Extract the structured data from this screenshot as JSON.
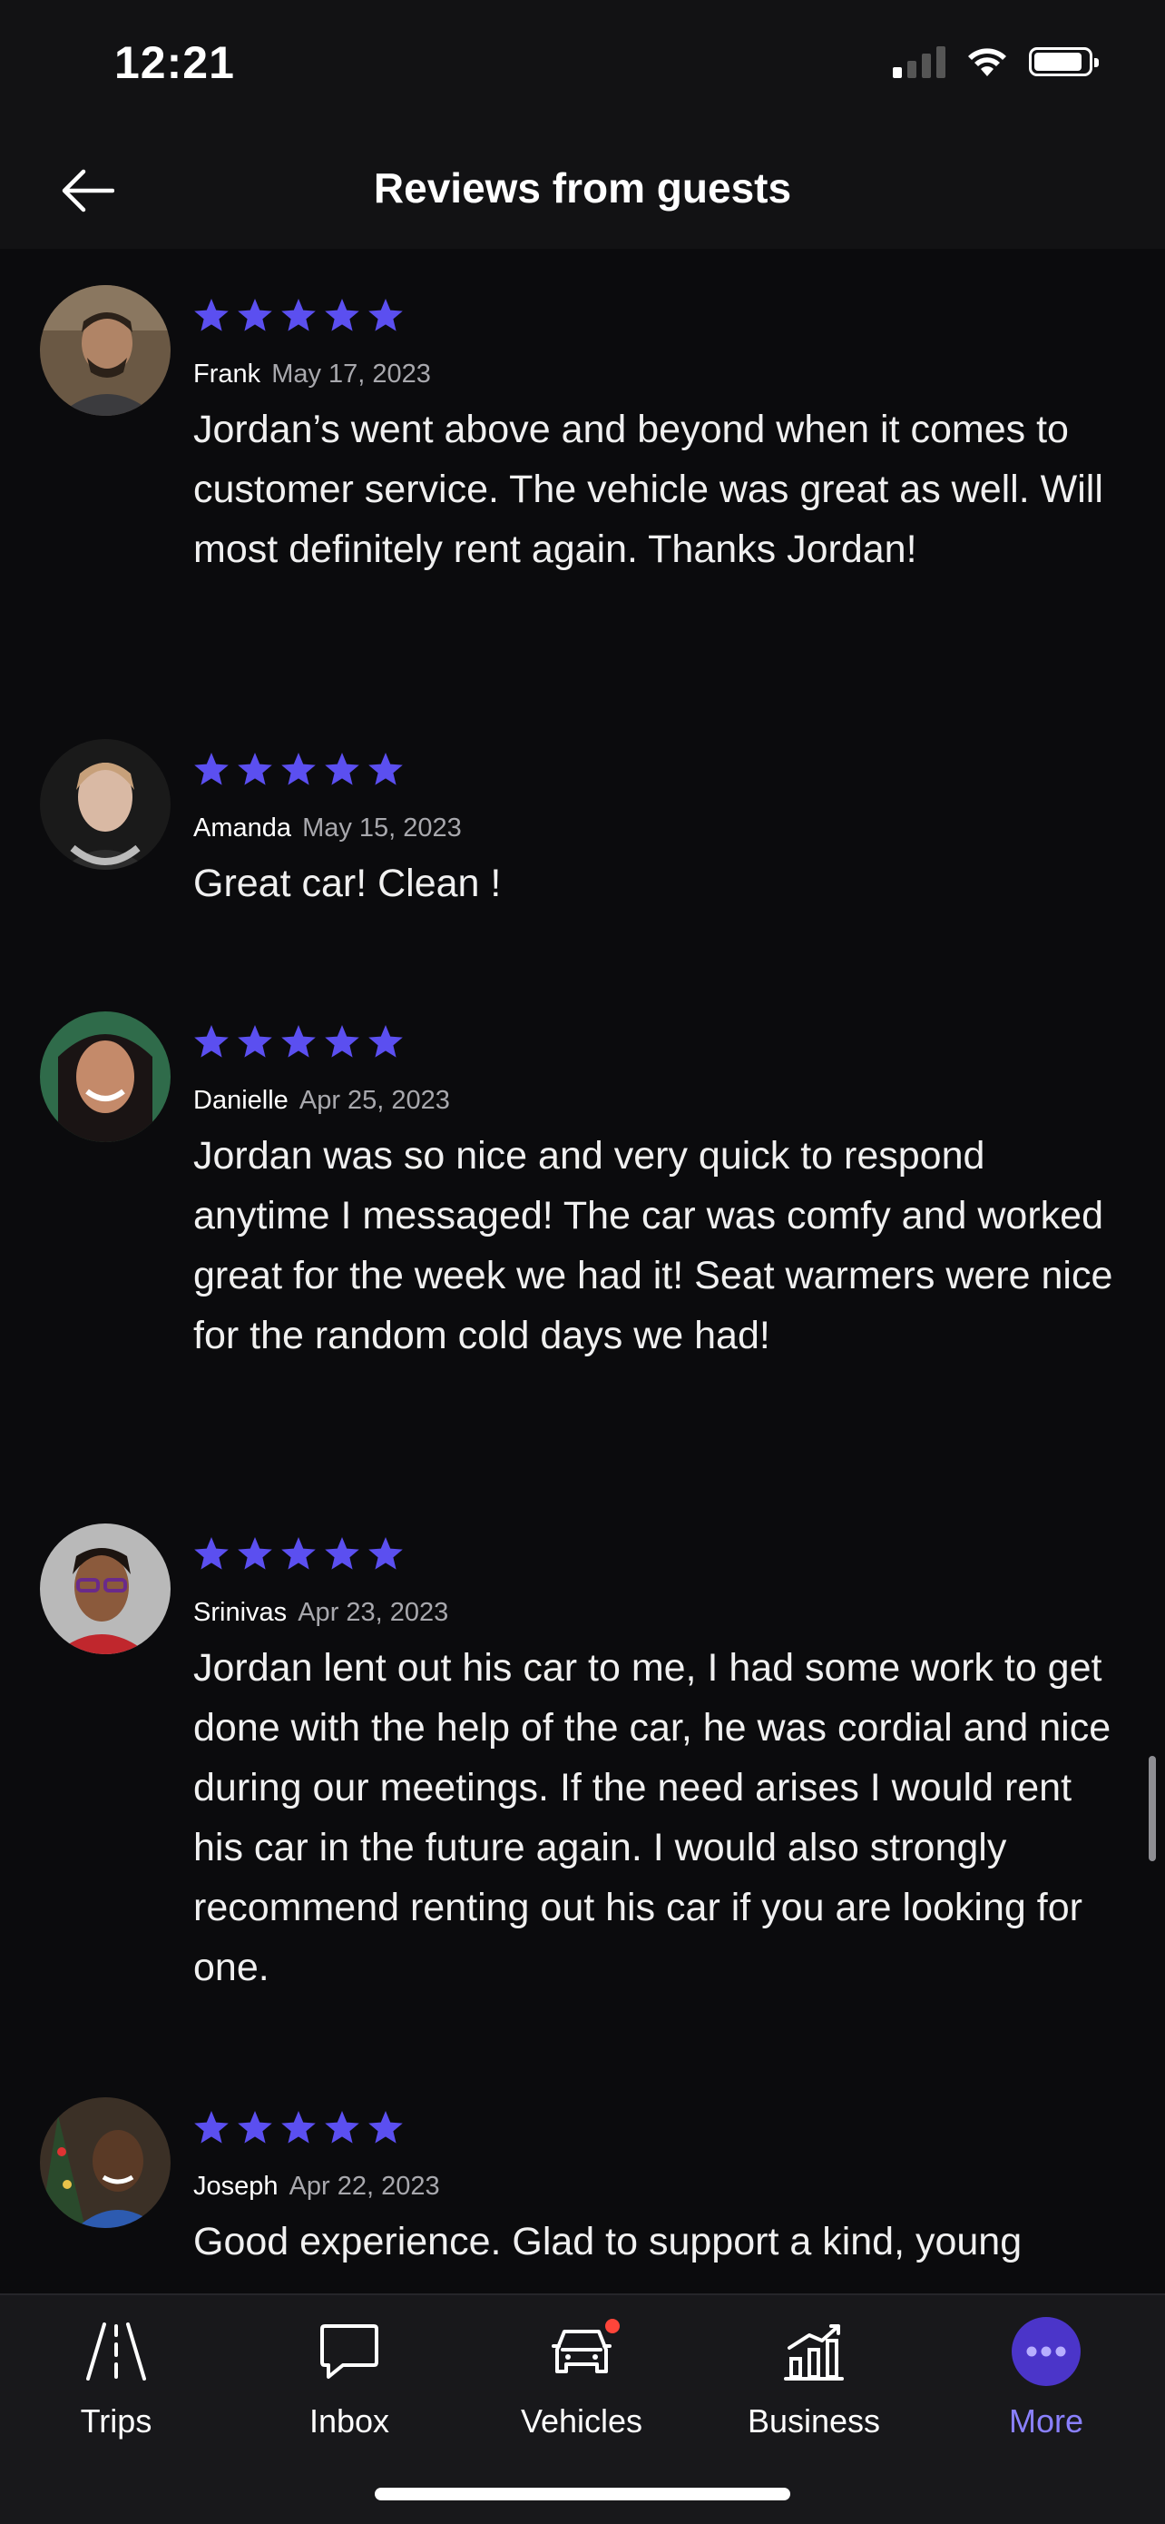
{
  "status_bar": {
    "time": "12:21"
  },
  "header": {
    "title": "Reviews from guests",
    "back_icon": "arrow-left-icon"
  },
  "colors": {
    "accent": "#6457f5",
    "star": "#5b4ff0",
    "background": "#0b0b0d",
    "badge": "#ff453a"
  },
  "reviews": [
    {
      "name": "Frank",
      "date": "May 17, 2023",
      "rating": 5,
      "text": "Jordan’s went above and beyond when it comes to customer service. The vehicle was great as well. Will most definitely rent again. Thanks Jordan!"
    },
    {
      "name": "Amanda",
      "date": "May 15, 2023",
      "rating": 5,
      "text": "Great car! Clean !"
    },
    {
      "name": "Danielle",
      "date": "Apr 25, 2023",
      "rating": 5,
      "text": "Jordan was so nice and very quick to respond anytime I messaged! The car was comfy and worked great for the week we had it! Seat warmers were nice for the random cold days we had!"
    },
    {
      "name": "Srinivas",
      "date": "Apr 23, 2023",
      "rating": 5,
      "text": "Jordan lent out his car to me, I had some work to get done with the help of the car, he was cordial and nice during our meetings. If the need arises I would rent his car in the future again. I would also strongly recommend renting out his car if you are looking for one."
    },
    {
      "name": "Joseph",
      "date": "Apr 22, 2023",
      "rating": 5,
      "text": "Good experience. Glad to support a kind, young"
    }
  ],
  "tabbar": {
    "items": [
      {
        "label": "Trips",
        "icon": "road-icon"
      },
      {
        "label": "Inbox",
        "icon": "chat-bubble-icon"
      },
      {
        "label": "Vehicles",
        "icon": "car-icon"
      },
      {
        "label": "Business",
        "icon": "bar-chart-icon"
      },
      {
        "label": "More",
        "icon": "more-dots-icon",
        "active": true
      }
    ]
  }
}
